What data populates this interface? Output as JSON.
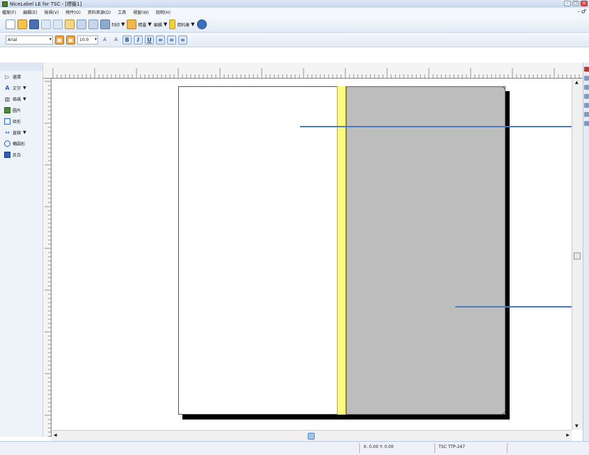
{
  "window": {
    "title": "NiceLabel LE for TSC - [標籤1]",
    "controls": [
      "–",
      "□",
      "×"
    ]
  },
  "menu": {
    "items": [
      "檔案(F)",
      "編輯(E)",
      "檢視(V)",
      "物件(O)",
      "資料來源(D)",
      "工具",
      "視窗(W)",
      "說明(H)"
    ],
    "restore_glyph": "- ♂"
  },
  "toolbar1": {
    "print_label": "列印",
    "wizard_label": "精靈",
    "edit_label": "編輯",
    "datasource_label": "資料庫"
  },
  "toolbar2": {
    "font_value": "Arial",
    "size_value": "10.0",
    "bold": "B",
    "italic": "I",
    "underline": "U",
    "grow": "A",
    "shrink": "A"
  },
  "tools": [
    {
      "label": "選擇",
      "icon": "pointer-icon"
    },
    {
      "label": "文字",
      "icon": "text-icon",
      "dropdown": true
    },
    {
      "label": "條碼",
      "icon": "barcode-icon",
      "dropdown": true
    },
    {
      "label": "圖片",
      "icon": "picture-icon"
    },
    {
      "label": "矩形",
      "icon": "rectangle-icon"
    },
    {
      "label": "直線",
      "icon": "line-icon",
      "dropdown": true
    },
    {
      "label": "橢圓形",
      "icon": "ellipse-icon"
    },
    {
      "label": "反白",
      "icon": "inverse-icon"
    }
  ],
  "status": {
    "coords": "X: 0.00 Y: 0.00",
    "printer": "TSC TTP-247"
  }
}
